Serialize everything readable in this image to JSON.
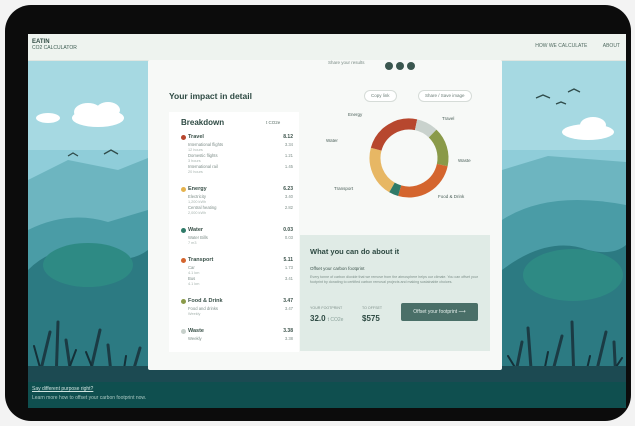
{
  "header": {
    "logo_title": "EATIN",
    "logo_subtitle": "CO2 CALCULATOR",
    "links": [
      "HOW WE CALCULATE",
      "ABOUT"
    ]
  },
  "intro_text": "Share your results",
  "impact": {
    "title": "Your impact in detail",
    "btn_copy": "Copy link",
    "btn_share": "Share / Save image"
  },
  "breakdown": {
    "title": "Breakdown",
    "unit": "t CO2e",
    "categories": [
      {
        "name": "Travel",
        "value": "8.12",
        "color": "#b7472e",
        "items": [
          {
            "label": "International flights",
            "value": "3.34",
            "note": "12 hours"
          },
          {
            "label": "Domestic flights",
            "value": "1.21",
            "note": "3 hours"
          },
          {
            "label": "International rail",
            "value": "1.45",
            "note": "20 hours"
          }
        ]
      },
      {
        "name": "Energy",
        "value": "6.23",
        "color": "#e5b24d",
        "items": [
          {
            "label": "Electricity",
            "value": "3.40",
            "note": "1,200 kWh"
          },
          {
            "label": "Central heating",
            "value": "2.82",
            "note": "2,000 kWh"
          }
        ]
      },
      {
        "name": "Water",
        "value": "0.03",
        "color": "#2f7a68",
        "items": [
          {
            "label": "Water Bills",
            "value": "0.03",
            "note": "7 m3"
          }
        ]
      },
      {
        "name": "Transport",
        "value": "5.11",
        "color": "#d4652e",
        "items": [
          {
            "label": "Car",
            "value": "1.73",
            "note": "4.1 km"
          },
          {
            "label": "Bus",
            "value": "3.41",
            "note": "4.1 km"
          }
        ]
      },
      {
        "name": "Food & Drink",
        "value": "3.47",
        "color": "#8a9a49",
        "items": [
          {
            "label": "Food and drinks",
            "value": "3.47",
            "note": "Weekly"
          }
        ]
      },
      {
        "name": "Waste",
        "value": "3.38",
        "color": "#c7d0cb",
        "items": [
          {
            "label": "Weekly",
            "value": "3.38",
            "note": ""
          }
        ]
      }
    ]
  },
  "donut": {
    "labels": [
      "Energy",
      "Travel",
      "Waste",
      "Food & Drink",
      "Transport",
      "Water"
    ],
    "colors": {
      "energy": "#e7b764",
      "travel": "#b7472e",
      "waste": "#c9d2cd",
      "food": "#8a9a49",
      "transport": "#d4652e",
      "water": "#2f7a68"
    }
  },
  "action": {
    "title": "What you can do about it",
    "subtitle": "Offset your carbon footprint",
    "text": "Every tonne of carbon dioxide that we remove from the atmosphere helps our climate. You can offset your footprint by donating to certified carbon removal projects and making sustainable choices.",
    "stat1_label": "YOUR FOOTPRINT",
    "stat1_value": "32.0",
    "stat1_unit": "t CO2e",
    "stat2_label": "TO OFFSET",
    "stat2_value": "$575",
    "button": "Offset your footprint"
  },
  "footer": {
    "link1": "Say different purpose right?",
    "link2": "Learn more how to offset your carbon footprint now."
  }
}
